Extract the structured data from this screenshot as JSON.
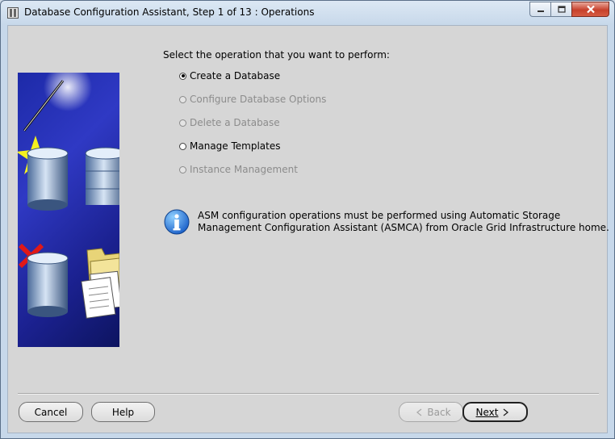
{
  "window": {
    "title": "Database Configuration Assistant, Step 1 of 13 : Operations",
    "controls": {
      "minimize": "minimize-icon",
      "maximize": "maximize-icon",
      "close": "close-icon"
    }
  },
  "prompt": "Select the operation that you want to perform:",
  "operations": [
    {
      "label": "Create a Database",
      "enabled": true,
      "selected": true
    },
    {
      "label": "Configure Database Options",
      "enabled": false,
      "selected": false
    },
    {
      "label": "Delete a Database",
      "enabled": false,
      "selected": false
    },
    {
      "label": "Manage Templates",
      "enabled": true,
      "selected": false
    },
    {
      "label": "Instance Management",
      "enabled": false,
      "selected": false
    }
  ],
  "info": {
    "icon": "info-icon",
    "line1": "ASM configuration operations must be performed using Automatic Storage",
    "line2": "Management Configuration Assistant (ASMCA) from Oracle Grid Infrastructure home."
  },
  "buttons": {
    "cancel": "Cancel",
    "help": "Help",
    "back": "Back",
    "next": "Next"
  },
  "colors": {
    "art_background": "#2f39c4",
    "close_button": "#c7412c",
    "dialog_background": "#d6d6d6"
  }
}
